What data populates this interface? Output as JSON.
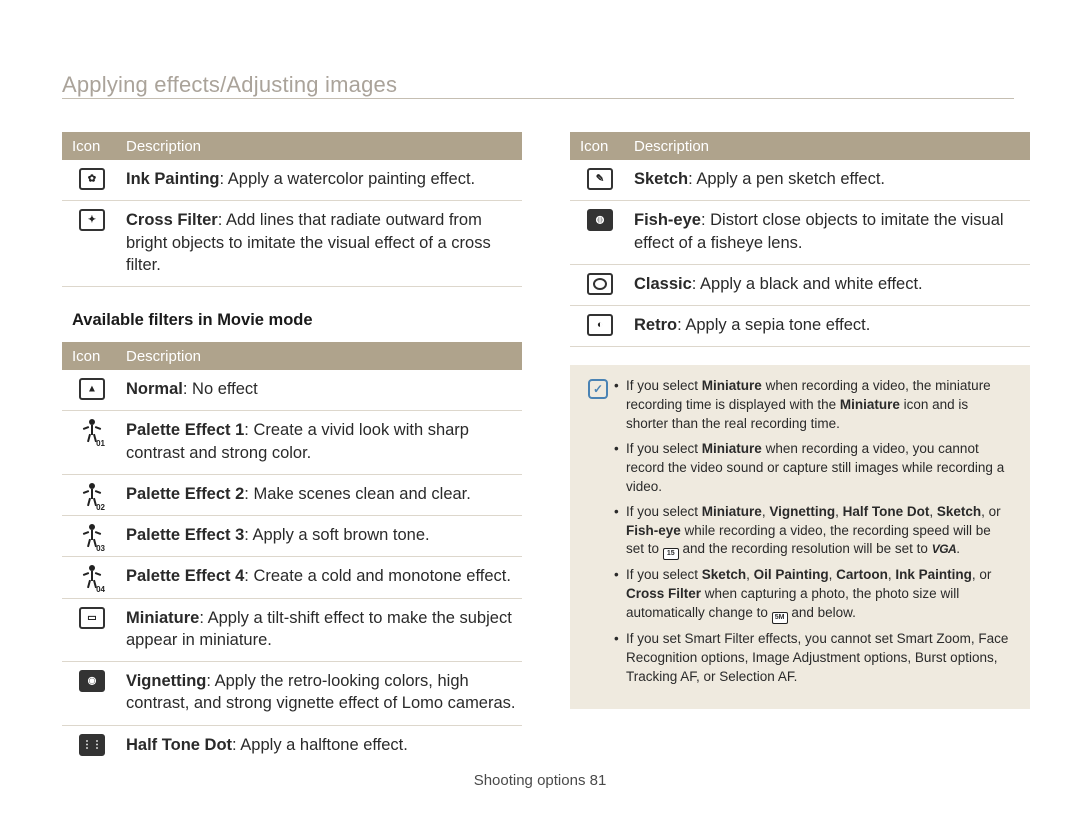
{
  "page_title": "Applying effects/Adjusting images",
  "footer_text": "Shooting options  81",
  "table_headers": {
    "icon": "Icon",
    "description": "Description"
  },
  "movie_subheading": "Available filters in Movie mode",
  "photo_filters_cont": [
    {
      "name": "Ink Painting",
      "desc": ": Apply a watercolor painting effect."
    },
    {
      "name": "Cross Filter",
      "desc": ": Add lines that radiate outward from bright objects to imitate the visual effect of a cross filter."
    }
  ],
  "movie_filters": [
    {
      "name": "Normal",
      "desc": ": No effect"
    },
    {
      "name": "Palette Effect 1",
      "desc": ": Create a vivid look with sharp contrast and strong color."
    },
    {
      "name": "Palette Effect 2",
      "desc": ": Make scenes clean and clear."
    },
    {
      "name": "Palette Effect 3",
      "desc": ": Apply a soft brown tone."
    },
    {
      "name": "Palette Effect 4",
      "desc": ": Create a cold and monotone effect."
    },
    {
      "name": "Miniature",
      "desc": ": Apply a tilt-shift effect to make the subject appear in miniature."
    },
    {
      "name": "Vignetting",
      "desc": ": Apply the retro-looking colors, high contrast, and strong vignette effect of Lomo cameras."
    },
    {
      "name": "Half Tone Dot",
      "desc": ": Apply a halftone effect."
    }
  ],
  "movie_filters_right": [
    {
      "name": "Sketch",
      "desc": ": Apply a pen sketch effect."
    },
    {
      "name": "Fish-eye",
      "desc": ": Distort close objects to imitate the visual effect of a fisheye lens."
    },
    {
      "name": "Classic",
      "desc": ": Apply a black and white effect."
    },
    {
      "name": "Retro",
      "desc": ": Apply a sepia tone effect."
    }
  ],
  "notes": {
    "n1a": "If you select ",
    "n1b": "Miniature",
    "n1c": " when recording a video, the miniature recording time is displayed with the ",
    "n1d": "Miniature",
    "n1e": " icon and is shorter than the real recording time.",
    "n2a": "If you select ",
    "n2b": "Miniature",
    "n2c": " when recording a video, you cannot record the video sound or capture still images while recording a video.",
    "n3a": "If you select ",
    "n3b": "Miniature",
    "n3c": ", ",
    "n3d": "Vignetting",
    "n3e": ", ",
    "n3f": "Half Tone Dot",
    "n3g": ", ",
    "n3h": "Sketch",
    "n3i": ", or ",
    "n3j": "Fish-eye",
    "n3k": " while recording a video, the recording speed will be set to ",
    "n3l": " and the recording resolution will be set to ",
    "n3m": ".",
    "n4a": "If you select ",
    "n4b": "Sketch",
    "n4c": ", ",
    "n4d": "Oil Painting",
    "n4e": ", ",
    "n4f": "Cartoon",
    "n4g": ", ",
    "n4h": "Ink Painting",
    "n4i": ", or ",
    "n4j": "Cross Filter",
    "n4k": " when capturing a photo, the photo size will automatically change to ",
    "n4l": " and below.",
    "n5": "If you set Smart Filter effects, you cannot set Smart Zoom, Face Recognition options, Image Adjustment options, Burst options, Tracking AF, or Selection AF.",
    "icon_15": "15",
    "icon_5m": "5M",
    "icon_vga": "VGA"
  }
}
